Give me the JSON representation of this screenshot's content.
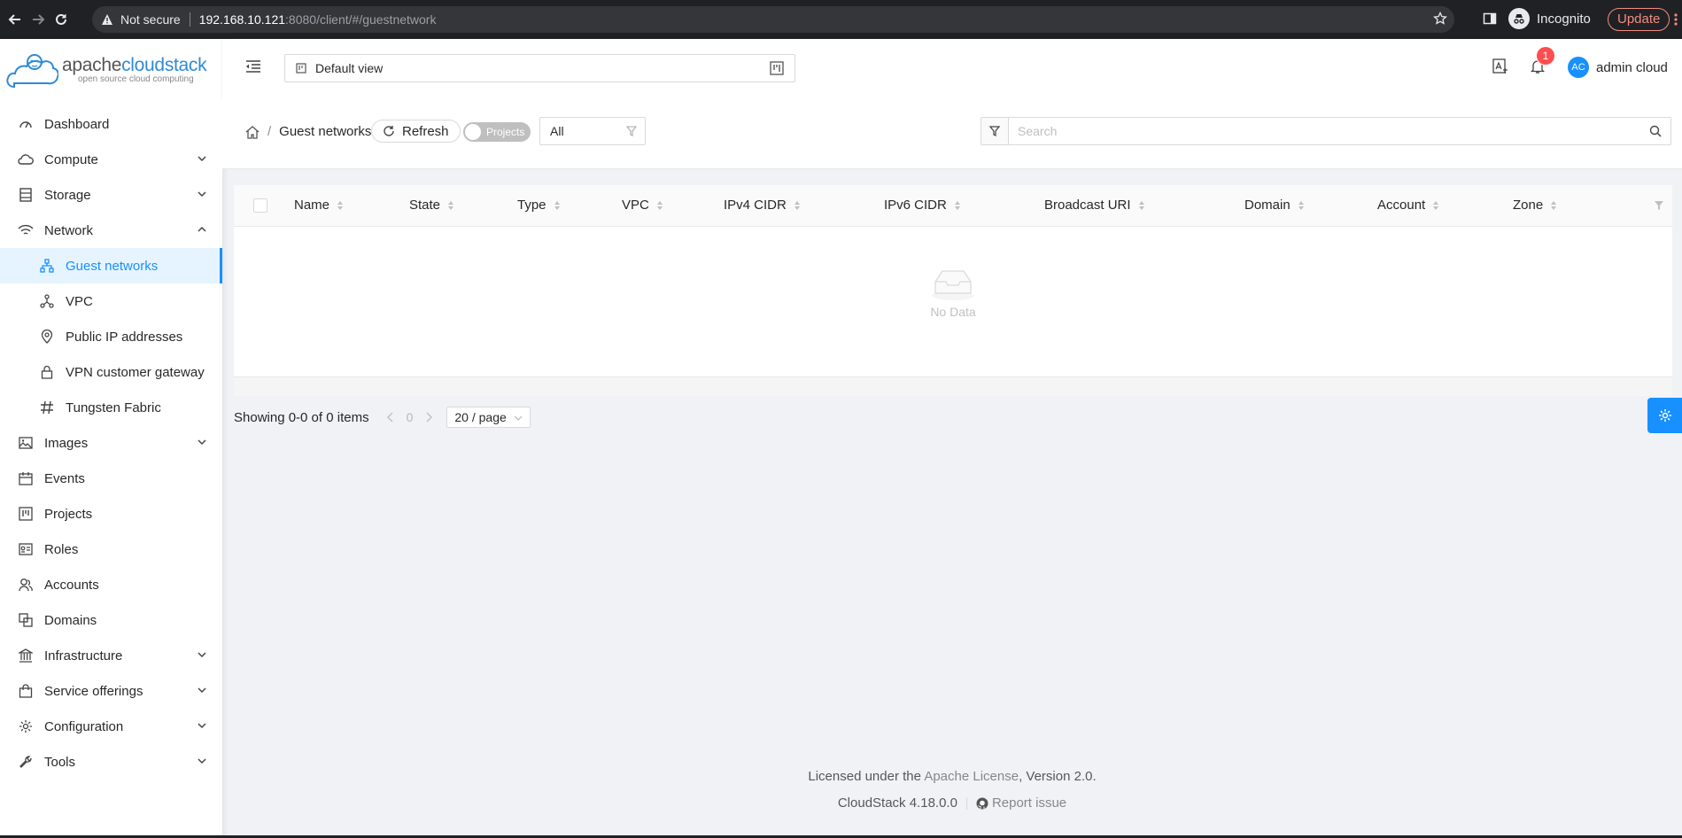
{
  "browser": {
    "security_label": "Not secure",
    "url_host": "192.168.10.121",
    "url_path": ":8080/client/#/guestnetwork",
    "profile_label": "Incognito",
    "update_label": "Update"
  },
  "logo": {
    "name_plain": "apache",
    "name_brand": "cloudstack",
    "tagline": "open source cloud computing"
  },
  "sidebar": {
    "items": [
      {
        "label": "Dashboard",
        "icon": "dashboard-icon"
      },
      {
        "label": "Compute",
        "icon": "cloud-icon",
        "expandable": true
      },
      {
        "label": "Storage",
        "icon": "database-icon",
        "expandable": true
      },
      {
        "label": "Network",
        "icon": "wifi-icon",
        "expanded": true
      },
      {
        "label": "Images",
        "icon": "picture-icon",
        "expandable": true
      },
      {
        "label": "Events",
        "icon": "schedule-icon"
      },
      {
        "label": "Projects",
        "icon": "project-icon"
      },
      {
        "label": "Roles",
        "icon": "idcard-icon"
      },
      {
        "label": "Accounts",
        "icon": "team-icon"
      },
      {
        "label": "Domains",
        "icon": "block-icon"
      },
      {
        "label": "Infrastructure",
        "icon": "bank-icon",
        "expandable": true
      },
      {
        "label": "Service offerings",
        "icon": "shopping-icon",
        "expandable": true
      },
      {
        "label": "Configuration",
        "icon": "setting-icon",
        "expandable": true
      },
      {
        "label": "Tools",
        "icon": "tool-icon",
        "expandable": true
      }
    ],
    "network_children": [
      {
        "label": "Guest networks",
        "icon": "apartment-icon",
        "active": true
      },
      {
        "label": "VPC",
        "icon": "deployment-unit-icon"
      },
      {
        "label": "Public IP addresses",
        "icon": "environment-icon"
      },
      {
        "label": "VPN customer gateway",
        "icon": "lock-icon"
      },
      {
        "label": "Tungsten Fabric",
        "icon": "tungsten-icon"
      }
    ]
  },
  "header": {
    "view_label": "Default view",
    "notification_count": "1",
    "avatar_initials": "AC",
    "user_name": "admin cloud"
  },
  "toolbar": {
    "breadcrumb_current": "Guest networks",
    "refresh_label": "Refresh",
    "projects_toggle_label": "Projects",
    "filter_value": "All",
    "search_placeholder": "Search"
  },
  "table": {
    "columns": [
      "Name",
      "State",
      "Type",
      "VPC",
      "IPv4 CIDR",
      "IPv6 CIDR",
      "Broadcast URI",
      "Domain",
      "Account",
      "Zone"
    ],
    "rows": [],
    "empty_text": "No Data"
  },
  "pagination": {
    "summary": "Showing 0-0 of 0 items",
    "current_page": "0",
    "page_size": "20 / page"
  },
  "footer": {
    "license_prefix": "Licensed under the ",
    "license_link": "Apache License",
    "license_suffix": ", Version 2.0.",
    "version": "CloudStack 4.18.0.0",
    "report_label": "Report issue"
  },
  "colors": {
    "accent": "#1890ff",
    "badge": "#ff4d4f",
    "browser_bar": "#202124"
  }
}
